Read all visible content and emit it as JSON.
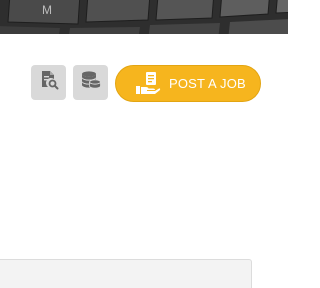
{
  "header": {
    "keyboard_key_label": "M"
  },
  "toolbar": {
    "search_document_icon": "document-search-icon",
    "coins_icon": "coins-stack-icon",
    "post_job": {
      "label": "POST A JOB",
      "icon": "hand-document-icon"
    }
  },
  "colors": {
    "accent": "#f6b51e",
    "icon_button_bg": "#d9d9d9",
    "icon_color": "#666666",
    "header_bg": "#3a3a3a"
  }
}
